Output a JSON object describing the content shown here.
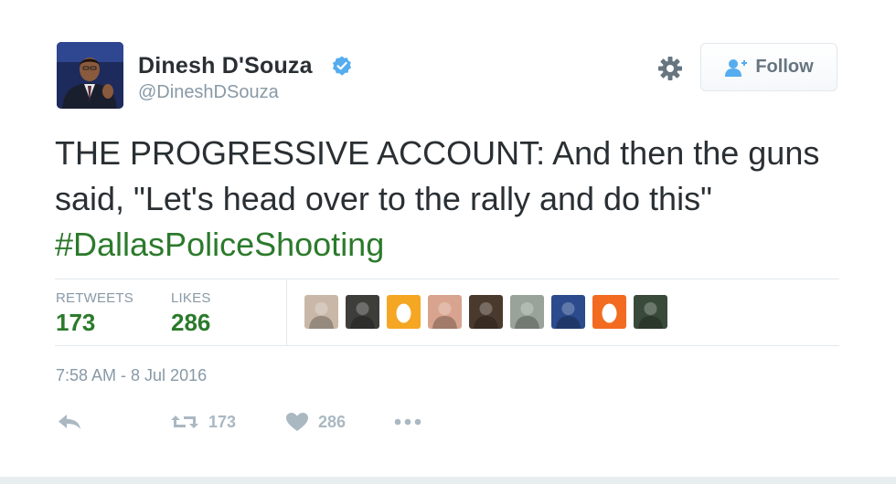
{
  "user": {
    "name": "Dinesh D'Souza",
    "handle": "@DineshDSouza",
    "verified": true
  },
  "follow_button": {
    "label": "Follow"
  },
  "tweet": {
    "text": "THE PROGRESSIVE ACCOUNT: And then the guns said, \"Let's head over to the rally and do this\" ",
    "hashtag": "#DallasPoliceShooting"
  },
  "stats": {
    "retweets_label": "RETWEETS",
    "retweets_value": "173",
    "likes_label": "LIKES",
    "likes_value": "286"
  },
  "likers": [
    {
      "name": "liker-1",
      "color": "#c9b8a8"
    },
    {
      "name": "liker-2",
      "color": "#3d3d3a"
    },
    {
      "name": "liker-3-egg",
      "color": "#f5a623"
    },
    {
      "name": "liker-4",
      "color": "#d9a48f"
    },
    {
      "name": "liker-5",
      "color": "#4a3a2e"
    },
    {
      "name": "liker-6",
      "color": "#9aa39a"
    },
    {
      "name": "liker-7",
      "color": "#2b4b8c"
    },
    {
      "name": "liker-8-egg",
      "color": "#f26b21"
    },
    {
      "name": "liker-9",
      "color": "#3a4a3a"
    }
  ],
  "timestamp": "7:58 AM - 8 Jul 2016",
  "actions": {
    "retweet_count": "173",
    "like_count": "286"
  },
  "colors": {
    "accent_green": "#2b7a2b",
    "muted": "#8899a6",
    "verified_blue": "#55acee"
  }
}
